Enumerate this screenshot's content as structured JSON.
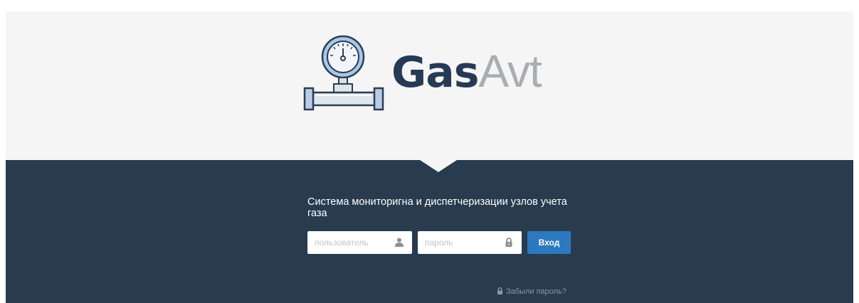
{
  "brand": {
    "logo_bold": "Gas",
    "logo_light": "Avt",
    "icon": "pressure-gauge-pipe-icon"
  },
  "colors": {
    "header_bg": "#f5f5f5",
    "panel_bg": "#283b4f",
    "brand_dark": "#273a55",
    "brand_light": "#a9aeb5",
    "button": "#2d79c0"
  },
  "login": {
    "subtitle": "Система мониторигна и диспетчеризации узлов учета газа",
    "username_placeholder": "пользователь",
    "username_icon": "user-icon",
    "password_placeholder": "пароль",
    "password_icon": "lock-icon",
    "submit_label": "Вход",
    "forgot_label": "Забыли пароль?",
    "forgot_icon": "lock-icon"
  }
}
